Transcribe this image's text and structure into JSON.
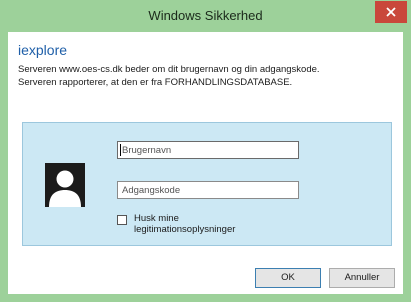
{
  "dialog": {
    "title": "Windows Sikkerhed",
    "close_icon": "close-icon",
    "app_name": "iexplore",
    "message_line1": "Serveren www.oes-cs.dk beder om dit brugernavn og din adgangskode.",
    "message_line2": "Serveren rapporterer, at den er fra FORHANDLINGSDATABASE."
  },
  "credentials": {
    "avatar_icon": "user-avatar-icon",
    "username_placeholder": "Brugernavn",
    "username_value": "",
    "password_placeholder": "Adgangskode",
    "password_value": "",
    "remember_label_line1": "Husk mine",
    "remember_label_line2": "legitimationsoplysninger",
    "remember_checked": false
  },
  "buttons": {
    "ok_label": "OK",
    "cancel_label": "Annuller"
  },
  "colors": {
    "titlebar": "#9dd19a",
    "close_button": "#c9473b",
    "accent_text": "#1f5fa8",
    "credential_panel": "#cce8f4"
  }
}
